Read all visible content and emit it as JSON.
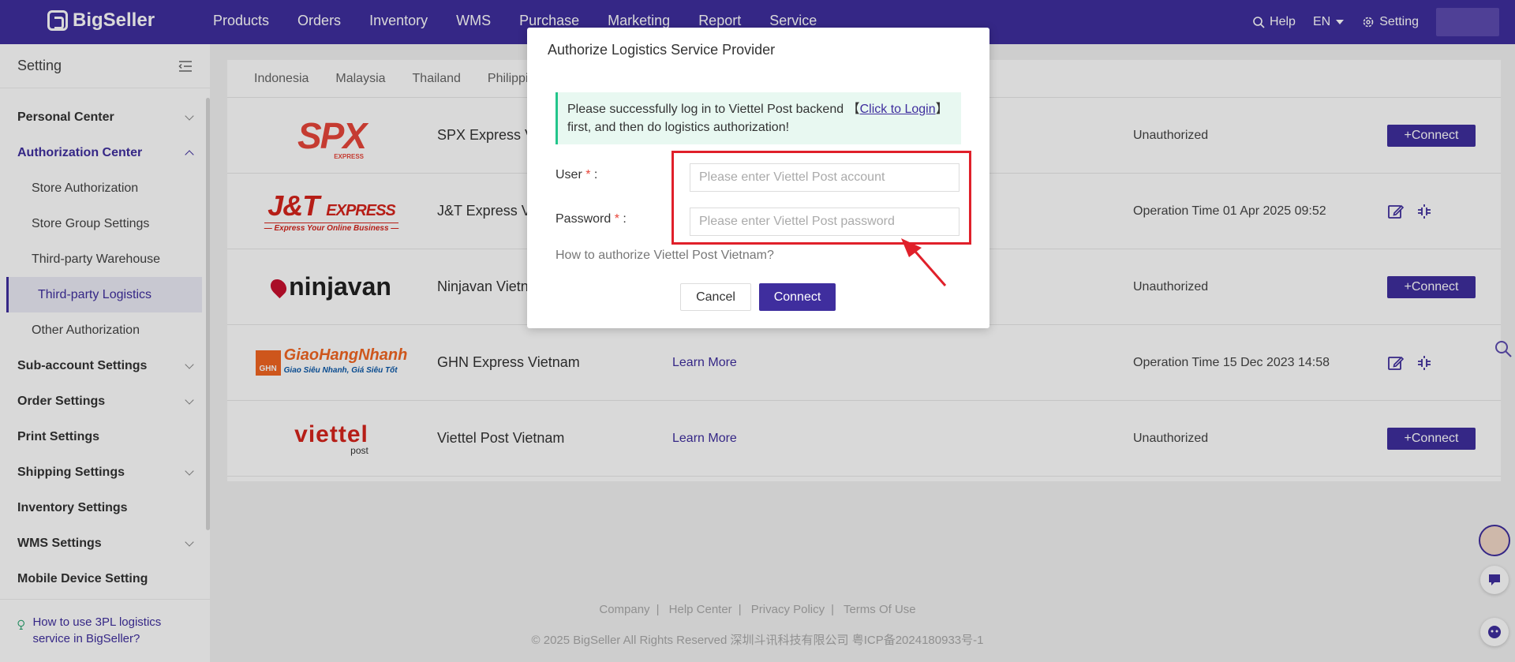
{
  "brand": {
    "name": "BigSeller"
  },
  "nav": {
    "items": [
      "Products",
      "Orders",
      "Inventory",
      "WMS",
      "Purchase",
      "Marketing",
      "Report",
      "Service"
    ],
    "help": "Help",
    "lang": "EN",
    "setting": "Setting"
  },
  "sidebar": {
    "title": "Setting",
    "items": [
      {
        "label": "Personal Center"
      },
      {
        "label": "Authorization Center"
      },
      {
        "label": "Store Authorization"
      },
      {
        "label": "Store Group Settings"
      },
      {
        "label": "Third-party Warehouse"
      },
      {
        "label": "Third-party Logistics"
      },
      {
        "label": "Other Authorization"
      },
      {
        "label": "Sub-account Settings"
      },
      {
        "label": "Order Settings"
      },
      {
        "label": "Print Settings"
      },
      {
        "label": "Shipping Settings"
      },
      {
        "label": "Inventory Settings"
      },
      {
        "label": "WMS Settings"
      },
      {
        "label": "Mobile Device Setting"
      }
    ],
    "help_text": "How to use 3PL logistics service in BigSeller?"
  },
  "tabs": [
    "Indonesia",
    "Malaysia",
    "Thailand",
    "Philippi"
  ],
  "providers": [
    {
      "name": "SPX Express V",
      "learn": "",
      "status": "Unauthorized",
      "action": "+Connect"
    },
    {
      "name": "J&T Express V",
      "learn": "",
      "status": "Operation Time 01 Apr 2025 09:52",
      "action": ""
    },
    {
      "name": "Ninjavan Vietn",
      "learn": "",
      "status": "Unauthorized",
      "action": "+Connect"
    },
    {
      "name": "GHN Express Vietnam",
      "learn": "Learn More",
      "status": "Operation Time 15 Dec 2023 14:58",
      "action": ""
    },
    {
      "name": "Viettel Post Vietnam",
      "learn": "Learn More",
      "status": "Unauthorized",
      "action": "+Connect"
    }
  ],
  "logos": {
    "spx": "SPX",
    "spx_sub": "EXPRESS",
    "jt": "J&T",
    "jt_express": "EXPRESS",
    "jt_tag": "— Express Your Online Business —",
    "ninja": "ninjavan",
    "ghn_box": "GHN",
    "ghn_name": "GiaoHangNhanh",
    "ghn_tag": "Giao Siêu Nhanh, Giá Siêu Tốt",
    "viettel": "viettel",
    "viettel_post": "post"
  },
  "modal": {
    "title": "Authorize Logistics Service Provider",
    "notice_pre": "Please successfully log in to Viettel Post backend 【",
    "notice_link": "Click to Login",
    "notice_post": "】 first, and then do logistics authorization!",
    "user_label": "User",
    "password_label": "Password",
    "user_placeholder": "Please enter Viettel Post account",
    "password_placeholder": "Please enter Viettel Post password",
    "howto": "How to authorize Viettel Post Vietnam?",
    "cancel": "Cancel",
    "connect": "Connect"
  },
  "footer": {
    "links": [
      "Company",
      "Help Center",
      "Privacy Policy",
      "Terms Of Use"
    ],
    "copyright": "© 2025 BigSeller All Rights Reserved    深圳斗讯科技有限公司    粤ICP备2024180933号-1"
  },
  "colors": {
    "brand": "#3f2e9e",
    "danger": "#e0202a",
    "notice_bg": "#e8f8f1"
  }
}
